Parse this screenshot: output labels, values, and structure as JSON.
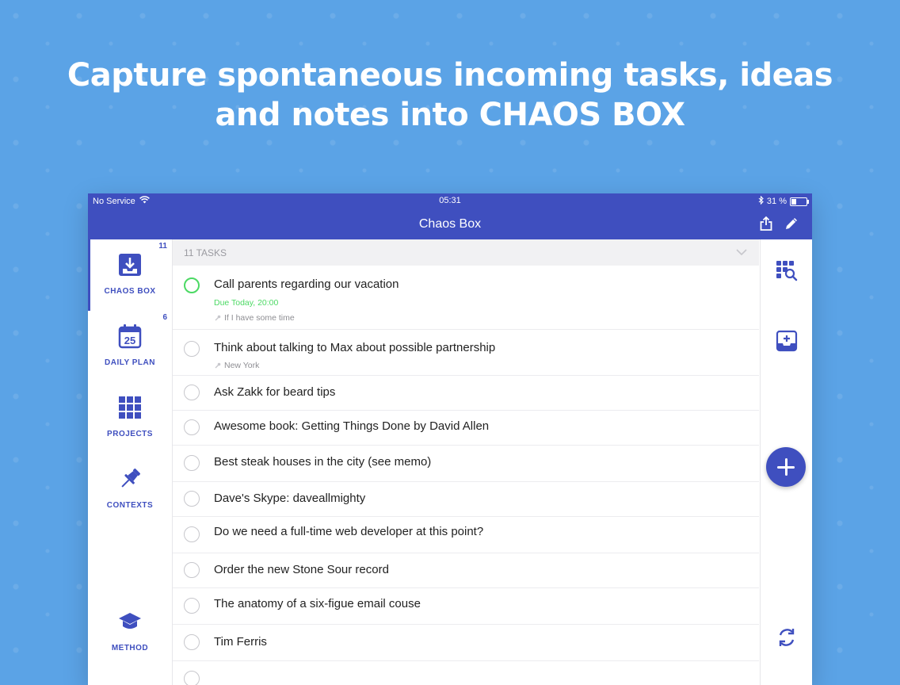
{
  "headline": {
    "line1": "Capture spontaneous incoming tasks, ideas",
    "line2_prefix": "and notes into ",
    "line2_strong": "CHAOS BOX"
  },
  "statusbar": {
    "carrier": "No Service",
    "time": "05:31",
    "battery": "31 %",
    "battery_level": 0.31
  },
  "navbar": {
    "title": "Chaos Box"
  },
  "sidebar": {
    "items": [
      {
        "label": "CHAOS BOX",
        "count": "11"
      },
      {
        "label": "DAILY PLAN",
        "count": "6",
        "day": "25"
      },
      {
        "label": "PROJECTS",
        "count": ""
      },
      {
        "label": "CONTEXTS",
        "count": ""
      },
      {
        "label": "METHOD",
        "count": ""
      }
    ]
  },
  "list": {
    "header": "11 TASKS",
    "tasks": [
      {
        "title": "Call parents regarding our vacation",
        "due": "Due Today, 20:00",
        "context": "If I have some time"
      },
      {
        "title": "Think about talking to Max about possible partnership",
        "context": "New York"
      },
      {
        "title": "Ask Zakk for beard tips"
      },
      {
        "title": "Awesome book: Getting Things Done by David Allen"
      },
      {
        "title": "Best steak houses in the city (see memo)"
      },
      {
        "title": "Dave's Skype: daveallmighty"
      },
      {
        "title": "Do we need a full-time web developer at this point?"
      },
      {
        "title": "Order the new Stone Sour record"
      },
      {
        "title": "The anatomy of a six-figue email couse"
      },
      {
        "title": "Tim Ferris"
      }
    ]
  },
  "colors": {
    "accent": "#3f4fbf",
    "due_green": "#4cd964",
    "background": "#5ba3e6"
  }
}
